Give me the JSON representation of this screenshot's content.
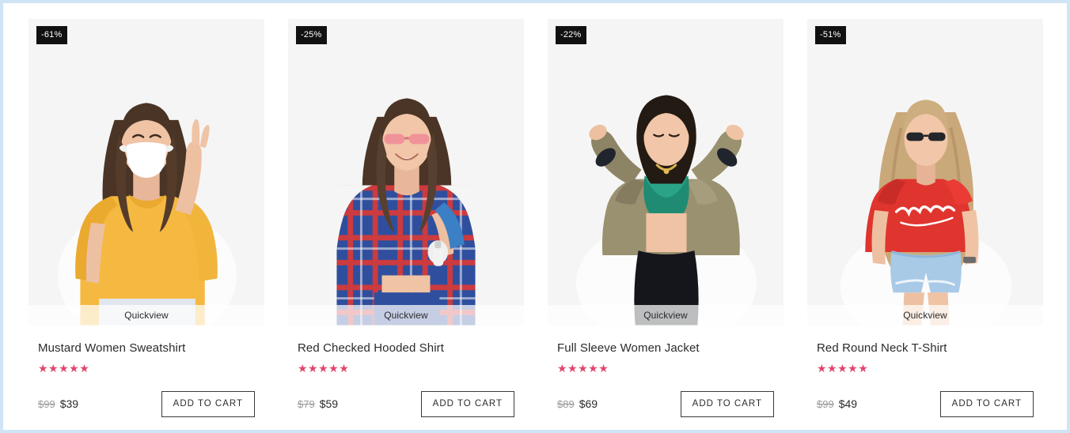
{
  "page": {
    "layout": "product-grid",
    "columns": 4,
    "accent_color": "#e0456b",
    "badge_bg": "#111111",
    "media_bg": "#f5f5f5",
    "frame_color": "#cfe4f5"
  },
  "products": [
    {
      "discount_badge": "-61%",
      "quickview_label": "Quickview",
      "title": "Mustard Women Sweatshirt",
      "rating_stars": "★★★★★",
      "rating_value": 5,
      "price_old": "$99",
      "price_new": "$39",
      "add_to_cart_label": "ADD TO CART",
      "image_alt": "woman in mustard yellow sweatshirt wearing a face mask making a peace sign"
    },
    {
      "discount_badge": "-25%",
      "quickview_label": "Quickview",
      "title": "Red Checked Hooded Shirt",
      "rating_stars": "★★★★★",
      "rating_value": 5,
      "price_old": "$79",
      "price_new": "$59",
      "add_to_cart_label": "ADD TO CART",
      "image_alt": "smiling woman in red and blue checked hooded shirt with sunglasses"
    },
    {
      "discount_badge": "-22%",
      "quickview_label": "Quickview",
      "title": "Full Sleeve Women Jacket",
      "rating_stars": "★★★★★",
      "rating_value": 5,
      "price_old": "$89",
      "price_new": "$69",
      "add_to_cart_label": "ADD TO CART",
      "image_alt": "woman in olive green full sleeve jacket over teal crop top"
    },
    {
      "discount_badge": "-51%",
      "quickview_label": "Quickview",
      "title": "Red Round Neck T-Shirt",
      "rating_stars": "★★★★★",
      "rating_value": 5,
      "price_old": "$99",
      "price_new": "$49",
      "add_to_cart_label": "ADD TO CART",
      "image_alt": "woman in red round neck t-shirt and denim shorts with sunglasses"
    }
  ]
}
